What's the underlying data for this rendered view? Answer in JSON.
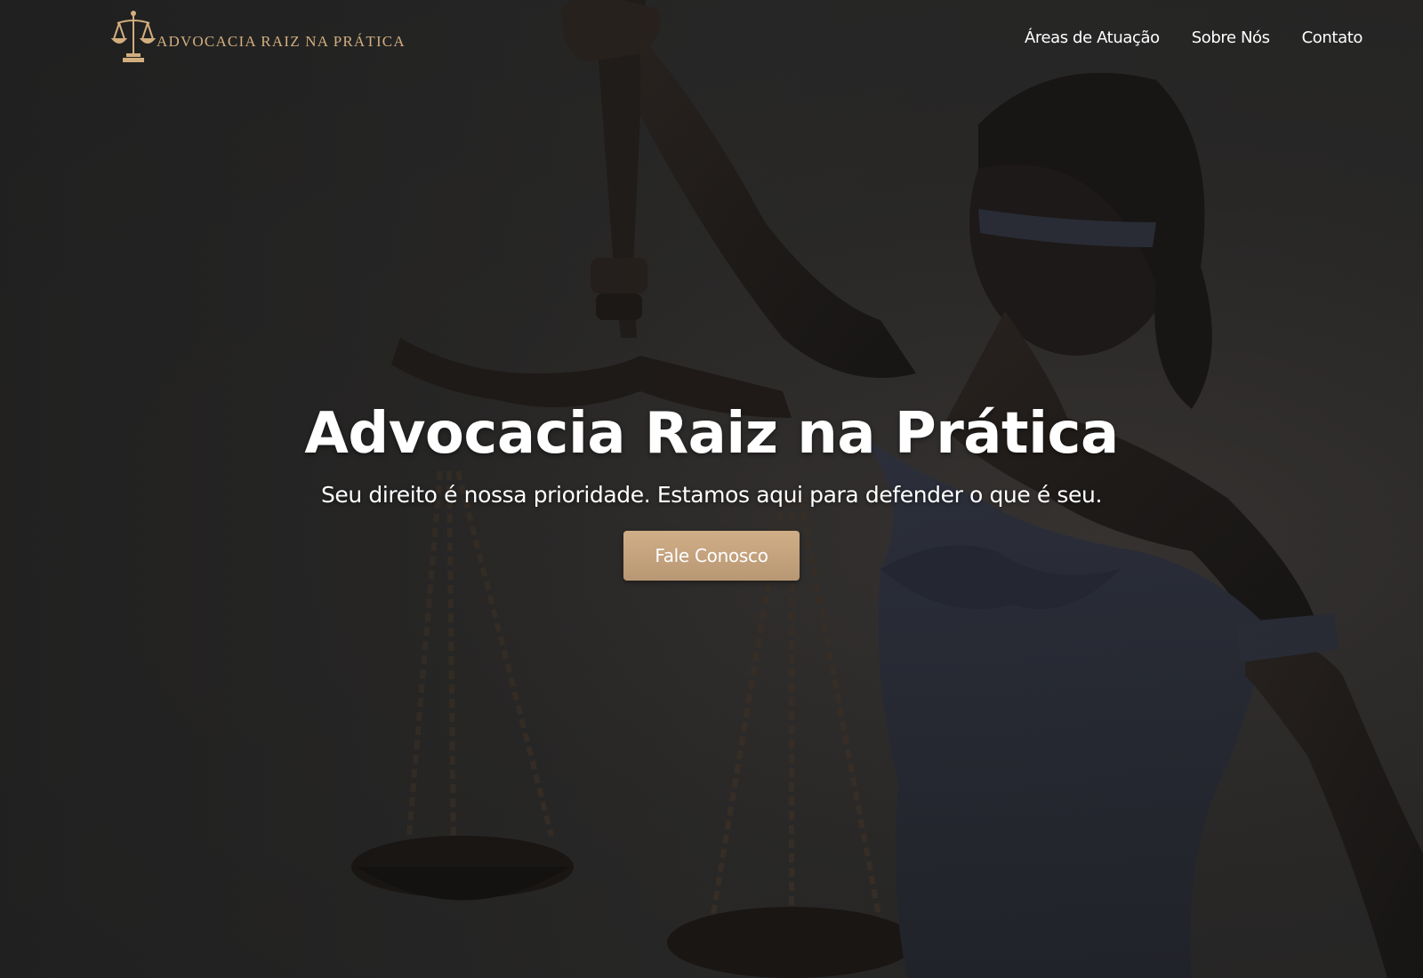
{
  "brand": {
    "name": "ADVOCACIA RAIZ NA PRÁTICA",
    "logo_icon": "scales-of-justice-icon",
    "accent_color": "#d2ae7e"
  },
  "nav": {
    "items": [
      {
        "label": "Áreas de Atuação"
      },
      {
        "label": "Sobre Nós"
      },
      {
        "label": "Contato"
      }
    ]
  },
  "hero": {
    "title": "Advocacia Raiz na Prática",
    "subtitle": "Seu direito é nossa prioridade. Estamos aqui para defender o que é seu.",
    "cta_label": "Fale Conosco",
    "cta_color": "#c9a780",
    "background": "lady-justice-statue-photo"
  }
}
